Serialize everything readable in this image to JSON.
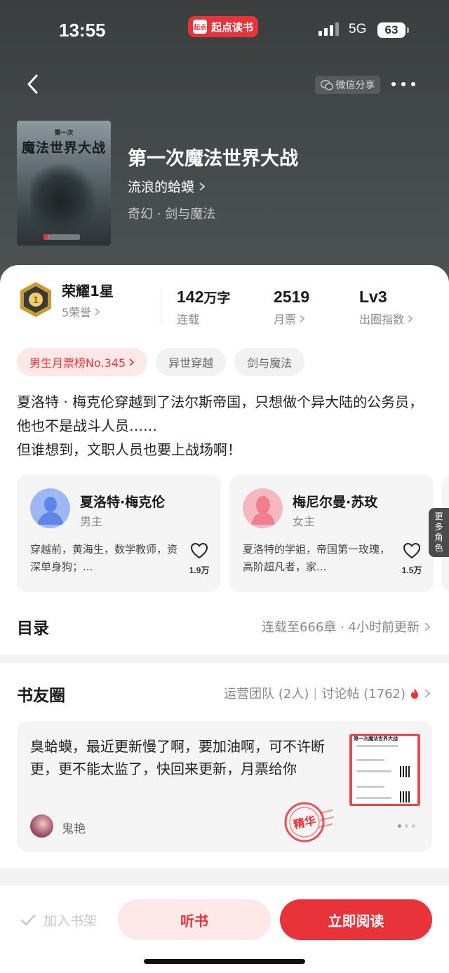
{
  "status_bar": {
    "time": "13:55",
    "app_badge": "起点读书",
    "app_logo_text": "起点",
    "network": "5G",
    "battery": "63"
  },
  "header": {
    "share_label": "微信分享",
    "back_icon": "chevron-left-icon",
    "more_icon": "more-dots-icon"
  },
  "book": {
    "cover_small_text": "第一次",
    "cover_title": "魔法世界大战",
    "title": "第一次魔法世界大战",
    "author": "流浪的蛤蟆",
    "genre": "奇幻 · 剑与魔法"
  },
  "honor": {
    "title": "荣耀1星",
    "sub": "5荣誉",
    "badge_number": "1"
  },
  "stats": [
    {
      "value": "142",
      "unit": "万字",
      "label": "连载"
    },
    {
      "value": "2519",
      "unit": "",
      "label": "月票"
    },
    {
      "value": "Lv3",
      "unit": "",
      "label": "出圈指数"
    }
  ],
  "tags": [
    "男生月票榜No.345",
    "异世穿越",
    "剑与魔法"
  ],
  "synopsis": {
    "line1": "夏洛特 · 梅克伦穿越到了法尔斯帝国，只想做个异大陆的公务员，他也不是战斗人员……",
    "line2": "但谁想到，文职人员也要上战场啊！"
  },
  "characters": [
    {
      "name": "夏洛特·梅克伦",
      "role": "男主",
      "desc": "穿越前，黄海生，数学教师，资深单身狗；...",
      "likes": "1.9万"
    },
    {
      "name": "梅尼尔曼·苏玫",
      "role": "女主",
      "desc": "夏洛特的学姐，帝国第一玫瑰，高阶超凡者，家...",
      "likes": "1.5万"
    }
  ],
  "more_characters": [
    "更",
    "多",
    "角",
    "色"
  ],
  "catalog": {
    "title": "目录",
    "info": "连载至666章 · 4小时前更新"
  },
  "circle": {
    "title": "书友圈",
    "team": "运营团队 (2人)",
    "separator": "|",
    "posts": "讨论帖 (1762)",
    "post_text": "臭蛤蟆，最近更新慢了啊，要加油啊，可不许断更，更不能太监了，快回来更新，月票给你",
    "post_user": "鬼艳",
    "thumb_title": "第一次魔法世界大战",
    "stamp_text": "精华"
  },
  "actions": {
    "shelf": "加入书架",
    "listen": "听书",
    "read": "立即阅读"
  },
  "colors": {
    "brand_red": "#e8333b",
    "rank_tag_bg": "#fde8e8",
    "hero_bg": "#3a3e3f"
  }
}
